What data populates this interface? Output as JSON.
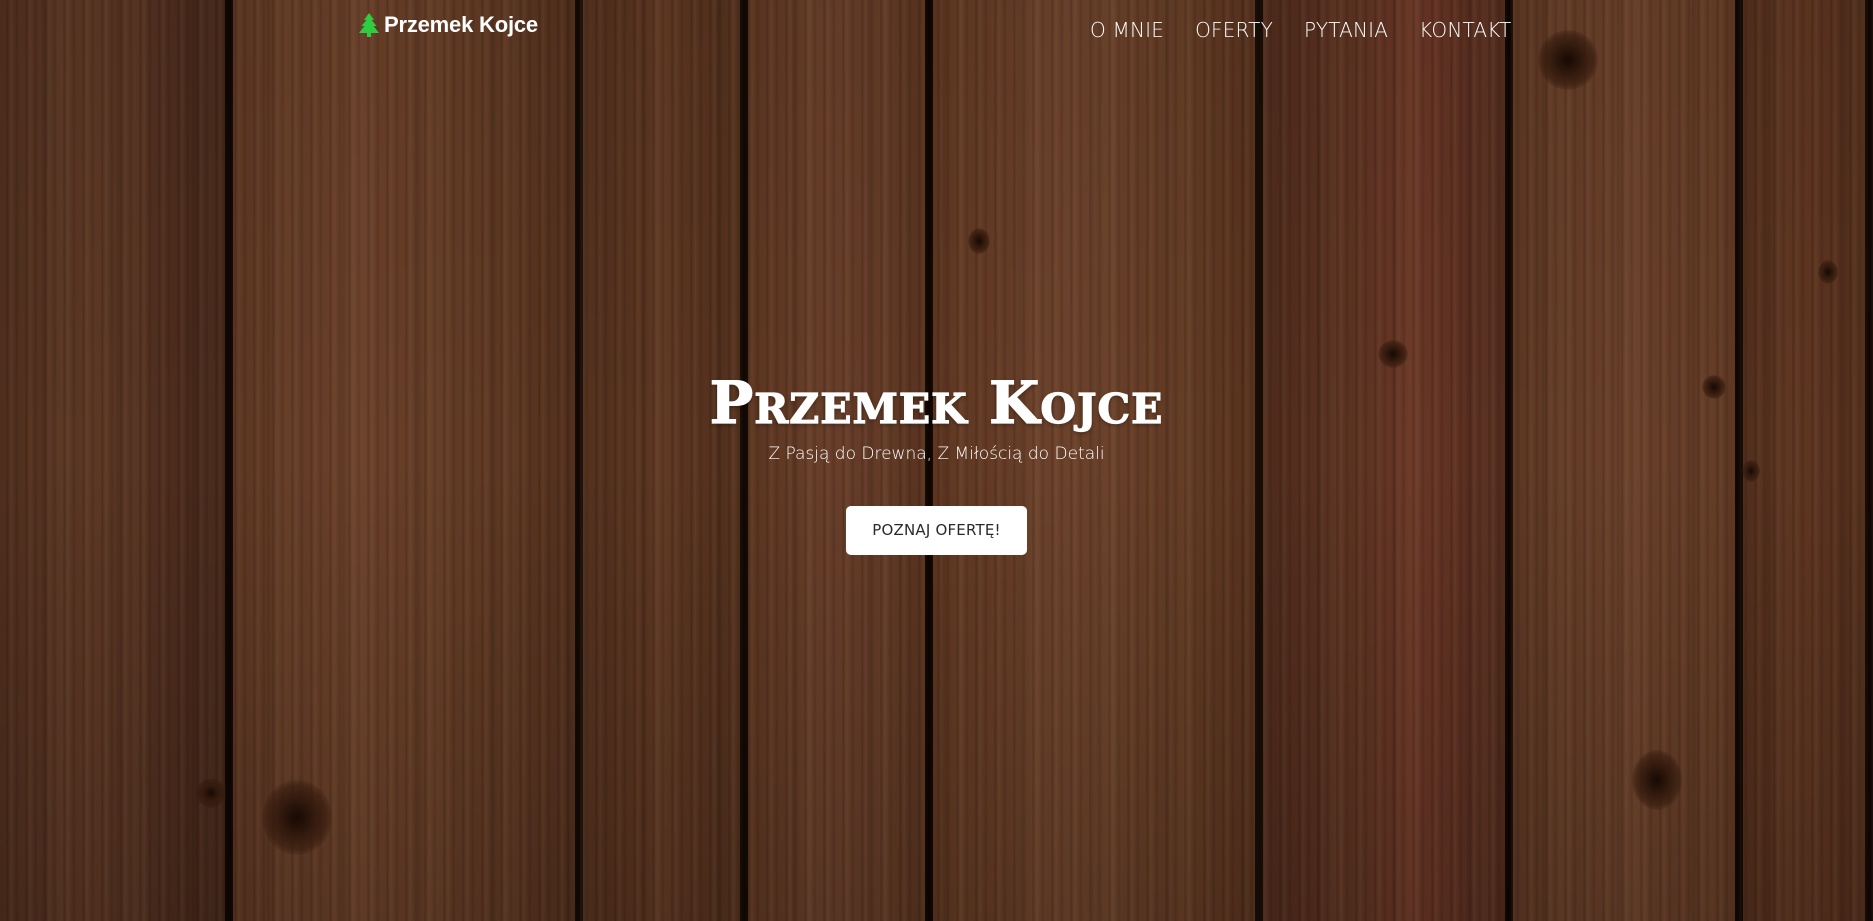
{
  "navbar": {
    "brand": {
      "icon": "tree-icon",
      "icon_color": "#2ecc40",
      "label": "Przemek Kojce"
    },
    "links": [
      {
        "label": "O MNIE"
      },
      {
        "label": "OFERTY"
      },
      {
        "label": "PYTANIA"
      },
      {
        "label": "KONTAKT"
      }
    ]
  },
  "hero": {
    "title": "Przemek Kojce",
    "subtitle": "Z Pasją do Drewna, Z Miłością do Detali",
    "cta_label": "POZNAJ OFERTĘ!",
    "background": "wood-planks-background"
  },
  "colors": {
    "text": "#ffffff",
    "button_bg": "#ffffff",
    "button_text": "#2a2a2a",
    "wood_base": "#6a3f28"
  }
}
